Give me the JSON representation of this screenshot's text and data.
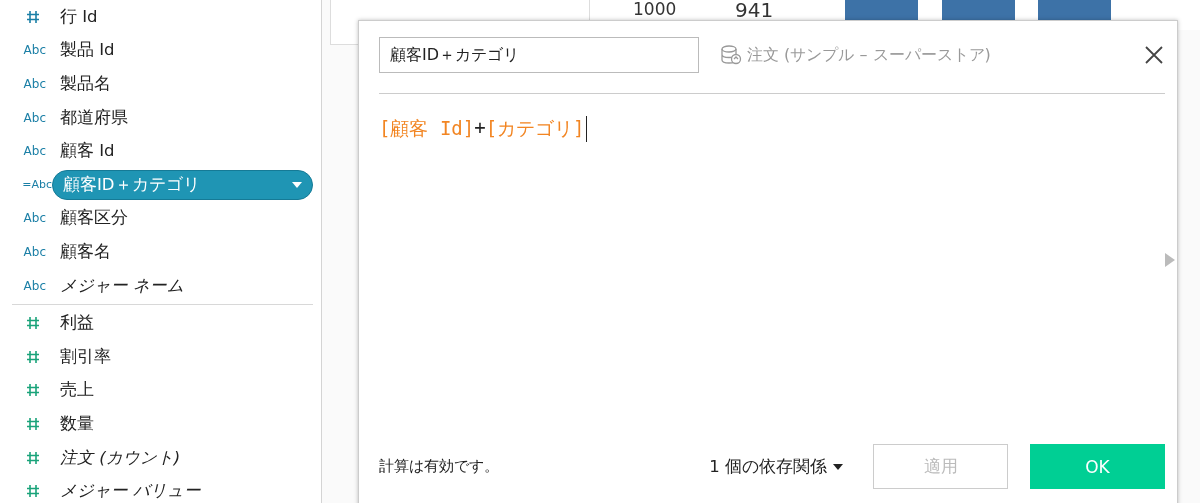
{
  "sidebar": {
    "sections": [
      {
        "fields": [
          {
            "kind": "measure",
            "name": "行 Id",
            "selected": false,
            "generated": false
          },
          {
            "kind": "dimension",
            "type_label": "Abc",
            "name": "製品 Id",
            "selected": false,
            "generated": false
          },
          {
            "kind": "dimension",
            "type_label": "Abc",
            "name": "製品名",
            "selected": false,
            "generated": false
          },
          {
            "kind": "dimension",
            "type_label": "Abc",
            "name": "都道府県",
            "selected": false,
            "generated": false
          },
          {
            "kind": "dimension",
            "type_label": "Abc",
            "name": "顧客 Id",
            "selected": false,
            "generated": false
          },
          {
            "kind": "calc",
            "type_label": "=Abc",
            "name": "顧客ID＋カテゴリ",
            "selected": true,
            "generated": false
          },
          {
            "kind": "dimension",
            "type_label": "Abc",
            "name": "顧客区分",
            "selected": false,
            "generated": false
          },
          {
            "kind": "dimension",
            "type_label": "Abc",
            "name": "顧客名",
            "selected": false,
            "generated": false
          },
          {
            "kind": "dimension",
            "type_label": "Abc",
            "name": "メジャー ネーム",
            "selected": false,
            "generated": true
          }
        ]
      },
      {
        "fields": [
          {
            "kind": "measure_value",
            "name": "利益",
            "selected": false,
            "generated": false
          },
          {
            "kind": "measure_value",
            "name": "割引率",
            "selected": false,
            "generated": false
          },
          {
            "kind": "measure_value",
            "name": "売上",
            "selected": false,
            "generated": false
          },
          {
            "kind": "measure_value",
            "name": "数量",
            "selected": false,
            "generated": false
          },
          {
            "kind": "measure_value",
            "name": "注文 (カウント)",
            "selected": false,
            "generated": true
          },
          {
            "kind": "measure_value",
            "name": "メジャー バリュー",
            "selected": false,
            "generated": true
          }
        ]
      }
    ]
  },
  "background_chart": {
    "axis_label": "1000",
    "bar_label": "941"
  },
  "dialog": {
    "name_field": {
      "value": "顧客ID＋カテゴリ"
    },
    "data_source": "注文 (サンプル – スーパーストア)",
    "formula": [
      {
        "kind": "field",
        "text": "[顧客 Id]"
      },
      {
        "kind": "operator",
        "text": "+"
      },
      {
        "kind": "field",
        "text": "[カテゴリ]"
      }
    ],
    "status": "計算は有効です。",
    "dependencies": "1 個の依存関係",
    "buttons": [
      {
        "kind": "secondary",
        "label": "適用",
        "disabled": true
      },
      {
        "kind": "primary",
        "label": "OK",
        "disabled": false
      }
    ]
  }
}
